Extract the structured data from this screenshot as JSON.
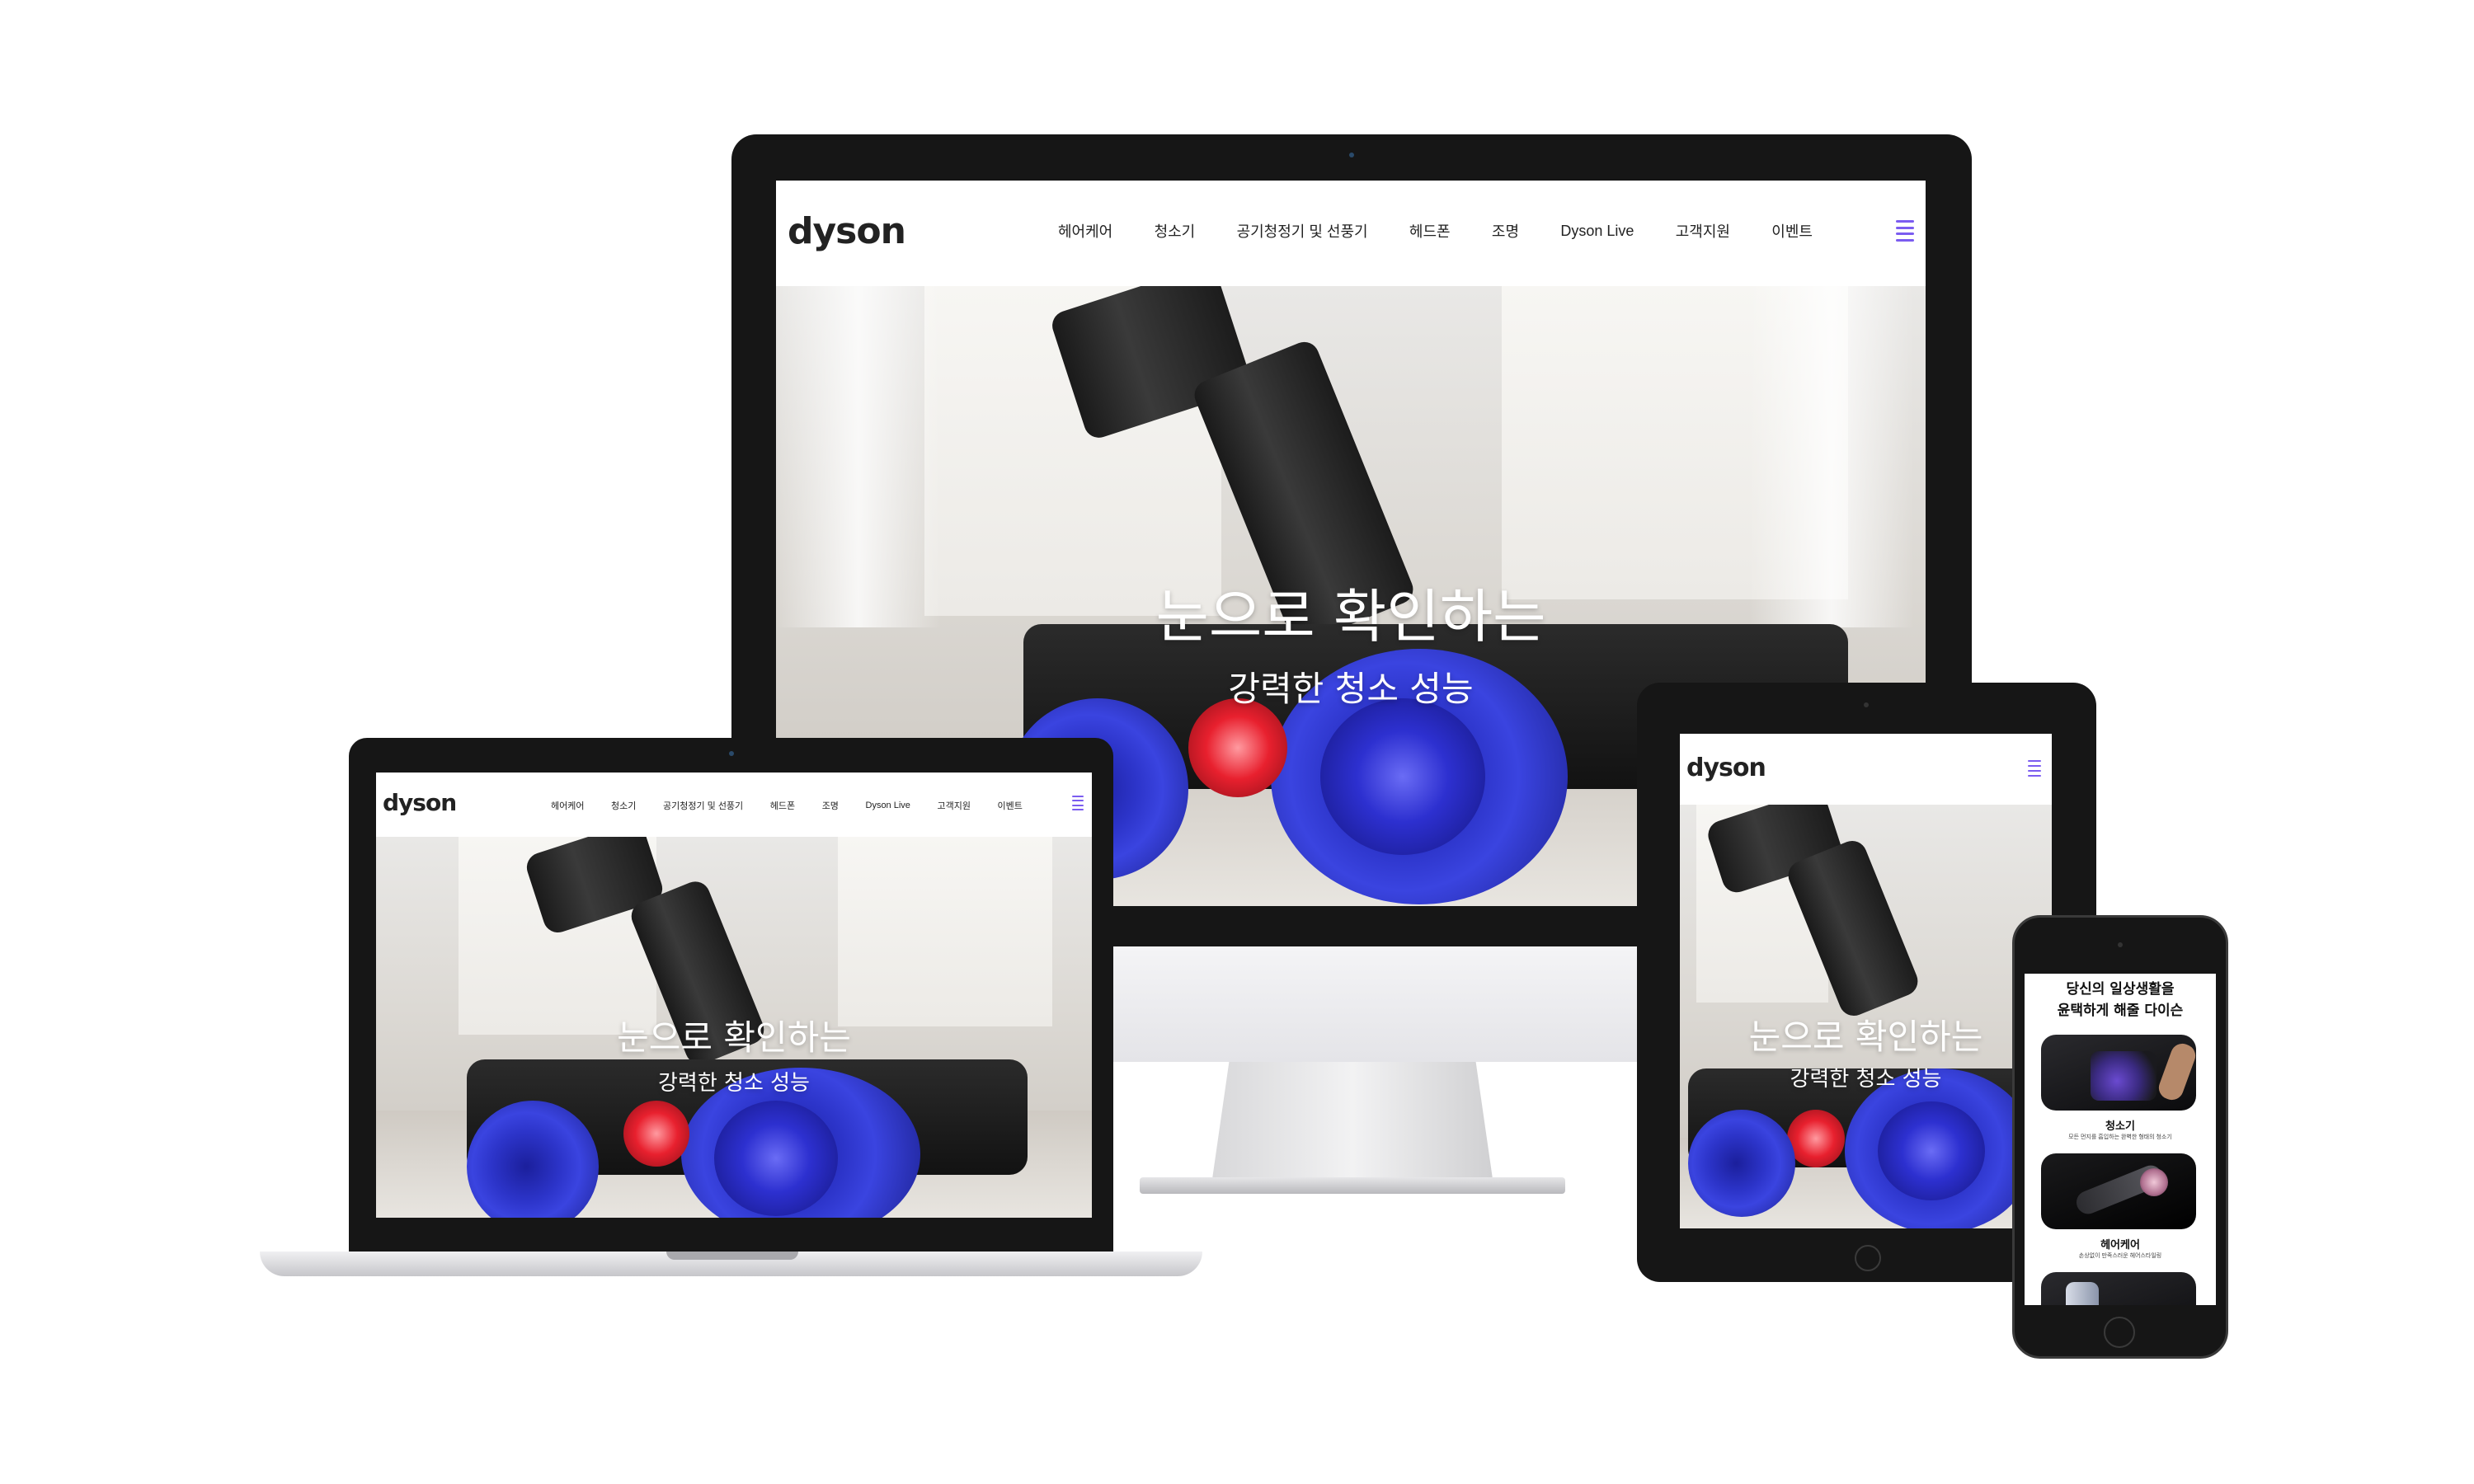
{
  "site": {
    "logo": "dyson",
    "nav": [
      "헤어케어",
      "청소기",
      "공기청정기 및 선풍기",
      "헤드폰",
      "조명",
      "Dyson Live",
      "고객지원",
      "이벤트"
    ],
    "accent": "#7b5cf0",
    "menu_icon": "hamburger-icon"
  },
  "hero": {
    "title": "눈으로 확인하는",
    "subtitle": "강력한 청소 성능"
  },
  "mobile": {
    "heading_line1": "당신의 일상생활을",
    "heading_line2": "윤택하게 해줄 다이슨",
    "cards": [
      {
        "label": "청소기",
        "desc": "모든 먼지를 흡입하는 완벽한 형태의 청소기"
      },
      {
        "label": "헤어케어",
        "desc": "손상없이 만족스러운 헤어스타일링"
      }
    ]
  }
}
